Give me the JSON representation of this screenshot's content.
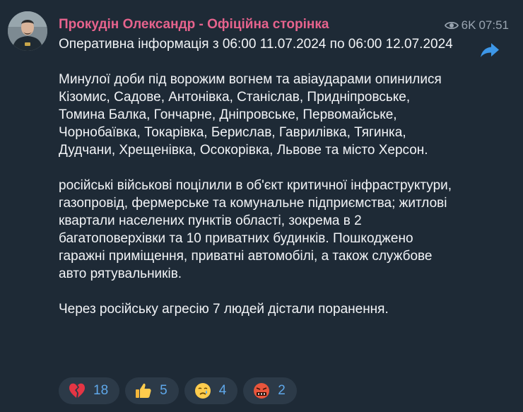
{
  "post": {
    "channel_name": "Прокудін Олександр - Офіційна сторінка",
    "views": "6K",
    "time": "07:51",
    "paragraphs": [
      "Оперативна інформація з 06:00 11.07.2024 по 06:00 12.07.2024",
      "Минулої доби під ворожим вогнем та авіаударами опинилися Кізомис, Садове, Антонівка, Станіслав, Придніпровське, Томина Балка, Гончарне, Дніпровське, Первомайське, Чорнобаївка, Токарівка, Берислав, Гаврилівка, Тягинка, Дудчани, Хрещенівка, Осокорівка, Львове та місто Херсон.",
      "російські військові поцілили в об'єкт критичної інфраструктури, газопровід, фермерське та комунальне підприємства; житлові квартали населених пунктів області, зокрема в 2 багатоповерхівки та 10 приватних будинків. Пошкоджено гаражні приміщення, приватні автомобілі, а також службове авто рятувальників.",
      "Через російську агресію 7 людей дістали поранення."
    ]
  },
  "icons": {
    "views": "eye-icon",
    "share": "share-arrow-icon",
    "avatar": "profile-photo"
  },
  "reactions": [
    {
      "emoji": "broken-heart",
      "count": "18"
    },
    {
      "emoji": "thumbs-up",
      "count": "5"
    },
    {
      "emoji": "crying-face",
      "count": "4"
    },
    {
      "emoji": "face-with-symbols-on-mouth",
      "count": "2"
    }
  ],
  "colors": {
    "background": "#1e2a36",
    "channel_name": "#e6638d",
    "meta": "#9aa5b1",
    "text": "#f2f4f7",
    "reaction_bg": "#2c3a48",
    "reaction_count": "#5fa8ea",
    "share_icon": "#3d97e8"
  }
}
